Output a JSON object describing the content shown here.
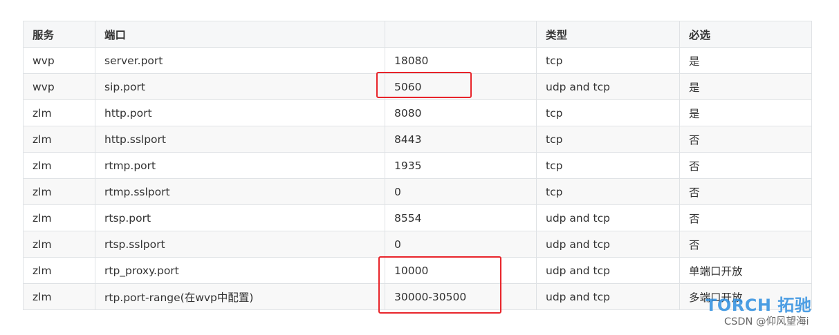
{
  "table": {
    "headers": [
      "服务",
      "端口",
      "",
      "类型",
      "必选"
    ],
    "rows": [
      {
        "service": "wvp",
        "port": "server.port",
        "value": "18080",
        "type": "tcp",
        "required": "是"
      },
      {
        "service": "wvp",
        "port": "sip.port",
        "value": "5060",
        "type": "udp and tcp",
        "required": "是"
      },
      {
        "service": "zlm",
        "port": "http.port",
        "value": "8080",
        "type": "tcp",
        "required": "是"
      },
      {
        "service": "zlm",
        "port": "http.sslport",
        "value": "8443",
        "type": "tcp",
        "required": "否"
      },
      {
        "service": "zlm",
        "port": "rtmp.port",
        "value": "1935",
        "type": "tcp",
        "required": "否"
      },
      {
        "service": "zlm",
        "port": "rtmp.sslport",
        "value": "0",
        "type": "tcp",
        "required": "否"
      },
      {
        "service": "zlm",
        "port": "rtsp.port",
        "value": "8554",
        "type": "udp and tcp",
        "required": "否"
      },
      {
        "service": "zlm",
        "port": "rtsp.sslport",
        "value": "0",
        "type": "udp and tcp",
        "required": "否"
      },
      {
        "service": "zlm",
        "port": "rtp_proxy.port",
        "value": "10000",
        "type": "udp and tcp",
        "required": "单端口开放"
      },
      {
        "service": "zlm",
        "port": "rtp.port-range(在wvp中配置)",
        "value": "30000-30500",
        "type": "udp and tcp",
        "required": "多端口开放"
      }
    ]
  },
  "watermark": {
    "logo": "TORCH 拓驰",
    "credit": "CSDN @仰风望海i"
  },
  "colors": {
    "highlight": "#e8242a",
    "logo": "#2f8fe0",
    "border": "#dfe2e5",
    "header_bg": "#f6f7f8",
    "stripe_bg": "#f8f8f8"
  }
}
